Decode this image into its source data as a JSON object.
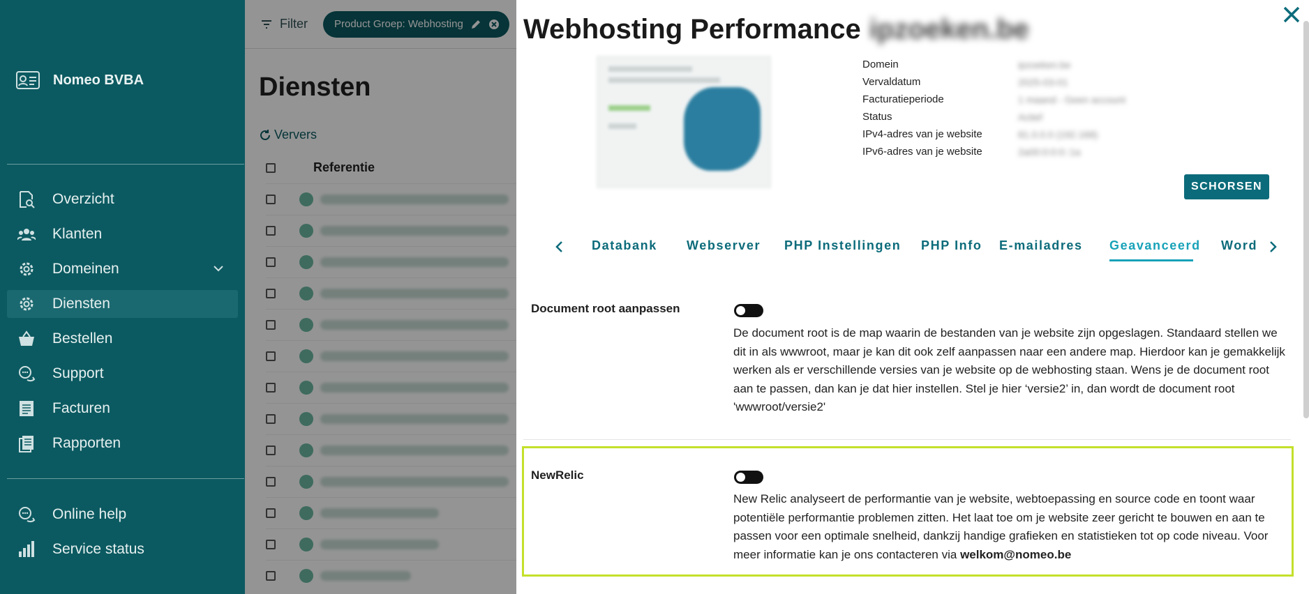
{
  "sidebar": {
    "brand": "Nomeo BVBA",
    "items": [
      {
        "label": "Overzicht",
        "icon": "search-document-icon"
      },
      {
        "label": "Klanten",
        "icon": "users-icon"
      },
      {
        "label": "Domeinen",
        "icon": "gear-icon"
      },
      {
        "label": "Diensten",
        "icon": "settings-gear-icon",
        "active": true
      },
      {
        "label": "Bestellen",
        "icon": "basket-icon"
      },
      {
        "label": "Support",
        "icon": "chat-icon"
      },
      {
        "label": "Facturen",
        "icon": "invoice-icon"
      },
      {
        "label": "Rapporten",
        "icon": "reports-icon"
      }
    ],
    "bottom_items": [
      {
        "label": "Online help",
        "icon": "help-chat-icon"
      },
      {
        "label": "Service status",
        "icon": "bar-chart-icon"
      }
    ]
  },
  "background": {
    "filter_label": "Filter",
    "chip_label": "Product Groep: Webhosting",
    "page_title": "Diensten",
    "refresh_label": "Ververs",
    "column_header": "Referentie"
  },
  "modal": {
    "title": "Webhosting Performance",
    "title_suffix": "ipzoeken.be",
    "info": [
      {
        "key": "Domein",
        "value": "ipzoeken.be"
      },
      {
        "key": "Vervaldatum",
        "value": "2025-03-01"
      },
      {
        "key": "Facturatieperiode",
        "value": "1 maand - Geen account"
      },
      {
        "key": "Status",
        "value": "Actief"
      },
      {
        "key": "IPv4-adres van je website",
        "value": "81.0.0.0 (192.168)"
      },
      {
        "key": "IPv6-adres van je website",
        "value": "2a00:0:0:0::1a"
      }
    ],
    "suspend_button": "SCHORSEN",
    "tabs": [
      "Databank",
      "Webserver",
      "PHP Instellingen",
      "PHP Info",
      "E-mailadres",
      "Geavanceerd",
      "Word"
    ],
    "active_tab": "Geavanceerd",
    "sections": [
      {
        "label": "Document root aanpassen",
        "description": "De document root is de map waarin de bestanden van je website zijn opgeslagen. Standaard stellen we dit in als wwwroot, maar je kan dit ook zelf aanpassen naar een andere map. Hierdoor kan je gemakkelijk werken als er verschillende versies van je website op de webhosting staan. Wens je de document root aan te passen, dan kan je dat hier instellen. Stel je hier ‘versie2’ in, dan wordt de document root 'wwwroot/versie2'"
      },
      {
        "label": "NewRelic",
        "description": "New Relic analyseert de performantie van je website, webtoepassing en source code en toont waar potentiële performantie problemen zitten. Het laat toe om je website zeer gericht te bouwen en aan te passen voor een optimale snelheid, dankzij handige grafieken en statistieken tot op code niveau. Voor meer informatie kan je ons contacteren via ",
        "email": "welkom@nomeo.be"
      }
    ]
  },
  "colors": {
    "sidebar": "#0c5a61",
    "accent": "#17a2b8",
    "button": "#0c6b7a",
    "highlight": "#c4e02a"
  }
}
